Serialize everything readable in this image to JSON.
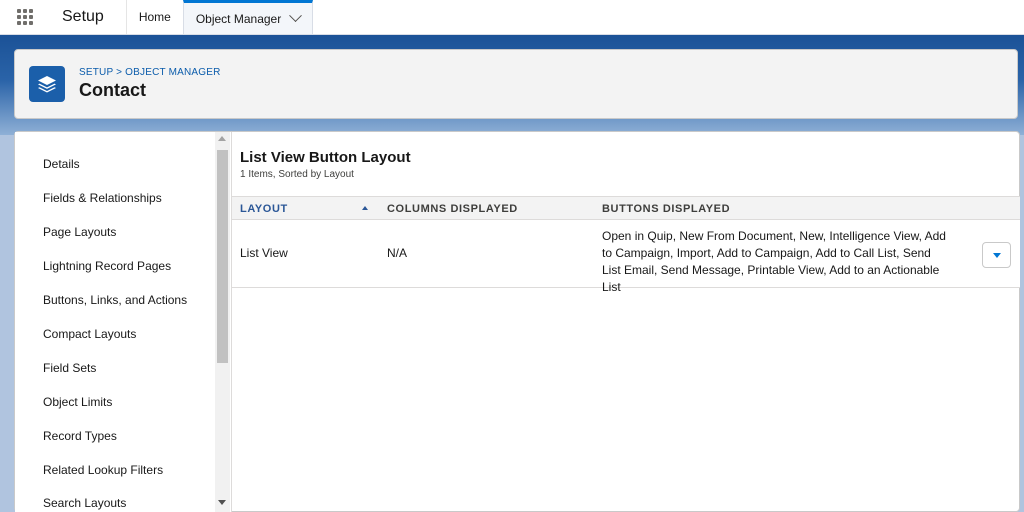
{
  "topbar": {
    "app_name": "Setup",
    "tabs": [
      {
        "label": "Home"
      },
      {
        "label": "Object Manager"
      }
    ]
  },
  "header": {
    "breadcrumb": "SETUP > OBJECT MANAGER",
    "title": "Contact"
  },
  "sidebar": {
    "items": [
      {
        "label": "Details"
      },
      {
        "label": "Fields & Relationships"
      },
      {
        "label": "Page Layouts"
      },
      {
        "label": "Lightning Record Pages"
      },
      {
        "label": "Buttons, Links, and Actions"
      },
      {
        "label": "Compact Layouts"
      },
      {
        "label": "Field Sets"
      },
      {
        "label": "Object Limits"
      },
      {
        "label": "Record Types"
      },
      {
        "label": "Related Lookup Filters"
      },
      {
        "label": "Search Layouts"
      }
    ]
  },
  "main": {
    "title": "List View Button Layout",
    "subtitle": "1 Items, Sorted by Layout",
    "columns": [
      {
        "label": "LAYOUT"
      },
      {
        "label": "COLUMNS DISPLAYED"
      },
      {
        "label": "BUTTONS DISPLAYED"
      }
    ],
    "rows": [
      {
        "layout": "List View",
        "columns_displayed": "N/A",
        "buttons_displayed": "Open in Quip, New From Document, New, Intelligence View, Add to Campaign, Import, Add to Campaign, Add to Call List, Send List Email, Send Message, Printable View, Add to an Actionable List"
      }
    ]
  },
  "colors": {
    "accent": "#0176d3",
    "header_band": "#1b5297",
    "object_icon": "#1b5faa"
  },
  "icons": {
    "app_launcher": "waffle-icon",
    "tab_menu": "chevron-down-icon",
    "object": "layers-icon",
    "sort": "sort-up-icon",
    "row_action": "dropdown-icon"
  }
}
